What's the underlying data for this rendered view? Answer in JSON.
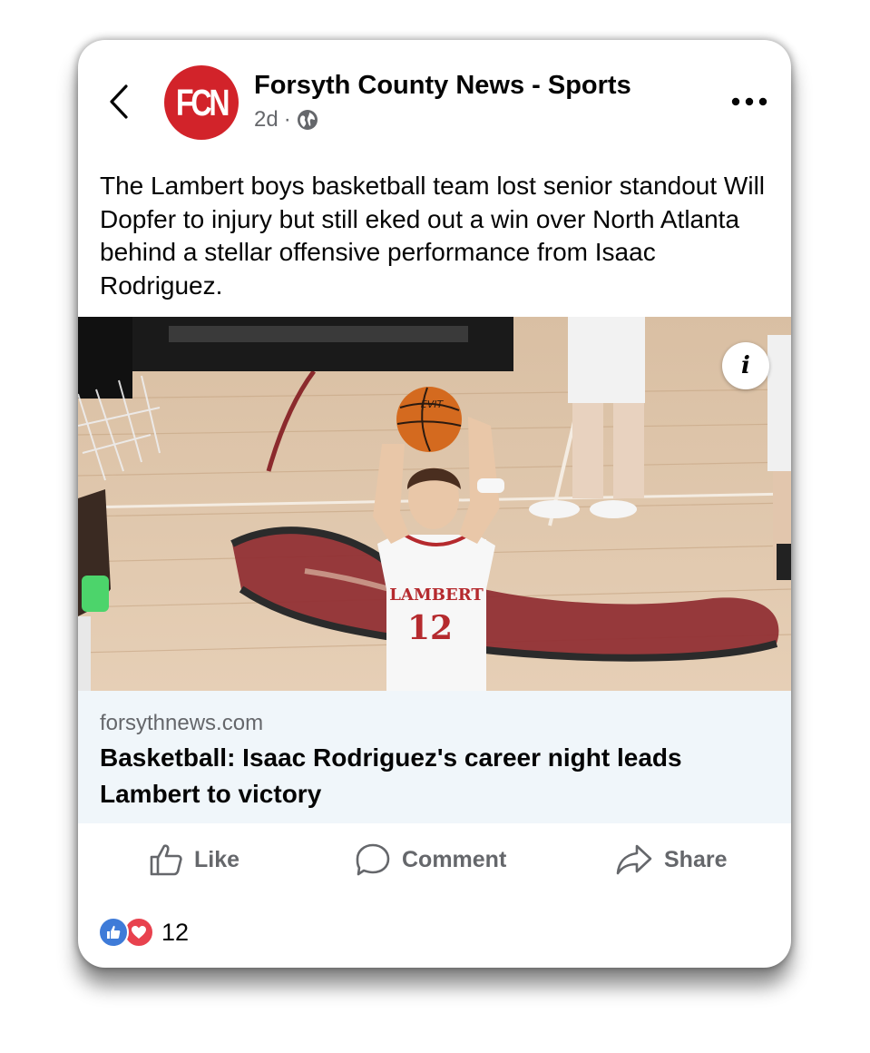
{
  "post": {
    "page_name": "Forsyth County News - Sports",
    "avatar_text": "FCN",
    "time_ago": "2d",
    "separator": "·",
    "body_text": "The Lambert boys basketball team lost senior standout Will Dopfer to injury but still eked out a win over North Atlanta behind a stellar offensive performance from Isaac Rodriguez."
  },
  "photo": {
    "jersey_team": "LAMBERT",
    "jersey_number": "12",
    "ball_text": "EVIT",
    "info_icon_label": "i"
  },
  "link": {
    "domain": "forsythnews.com",
    "title": "Basketball: Isaac Rodriguez's career night leads Lambert to victory"
  },
  "actions": {
    "like": "Like",
    "comment": "Comment",
    "share": "Share"
  },
  "reactions": {
    "count": "12",
    "types": [
      "like",
      "love"
    ]
  },
  "colors": {
    "brand_red": "#d2232a",
    "like_blue": "#3e7bd8",
    "love_red": "#e8424e",
    "link_bg": "#f0f6fa",
    "secondary_text": "#65676b"
  },
  "icons": {
    "back": "chevron-left-icon",
    "more": "more-horizontal-icon",
    "audience": "globe-icon",
    "info": "info-icon",
    "like": "thumbs-up-icon",
    "comment": "comment-bubble-icon",
    "share": "share-arrow-icon"
  }
}
